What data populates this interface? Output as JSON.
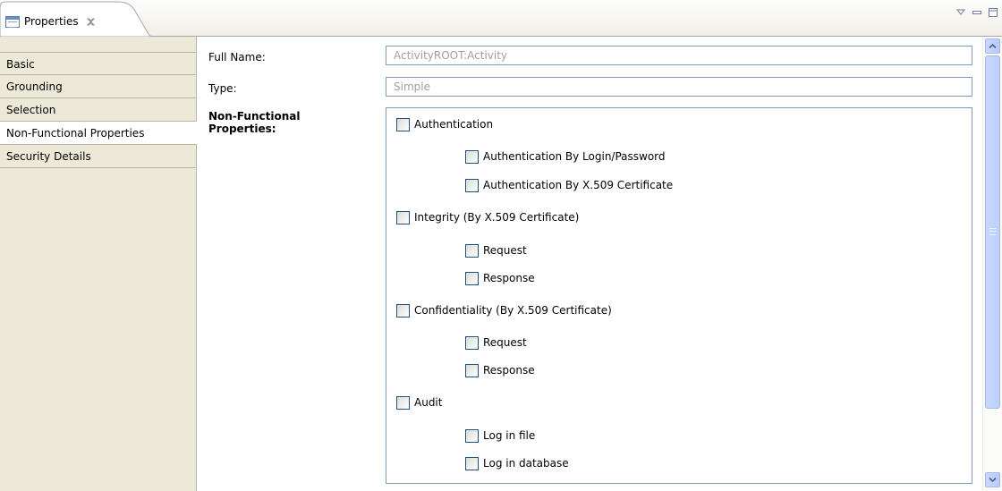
{
  "view": {
    "tab_label": "Properties",
    "tab_icon": "properties-table-icon",
    "controls": [
      "view-menu-icon",
      "minimize-icon",
      "maximize-icon"
    ]
  },
  "categories": [
    {
      "label": "Basic",
      "selected": false
    },
    {
      "label": "Grounding",
      "selected": false
    },
    {
      "label": "Selection",
      "selected": false
    },
    {
      "label": "Non-Functional Properties",
      "selected": true
    },
    {
      "label": "Security Details",
      "selected": false
    }
  ],
  "form": {
    "full_name_label": "Full Name:",
    "full_name_value": "ActivityROOT:Activity",
    "type_label": "Type:",
    "type_value": "Simple",
    "nfp_label_line1": "Non-Functional",
    "nfp_label_line2": "Properties:"
  },
  "checkboxes": {
    "authentication": "Authentication",
    "auth_login": "Authentication By Login/Password",
    "auth_x509": "Authentication By X.509 Certificate",
    "integrity": "Integrity (By X.509 Certificate)",
    "integrity_request": "Request",
    "integrity_response": "Response",
    "confidentiality": "Confidentiality (By X.509 Certificate)",
    "conf_request": "Request",
    "conf_response": "Response",
    "audit": "Audit",
    "log_file": "Log in file",
    "log_db": "Log in database"
  },
  "colors": {
    "panel_bg": "#ece9d8",
    "field_border": "#7f9db9",
    "disabled_text": "#a0a0a0",
    "scrollbar": "#c1d3fb"
  }
}
